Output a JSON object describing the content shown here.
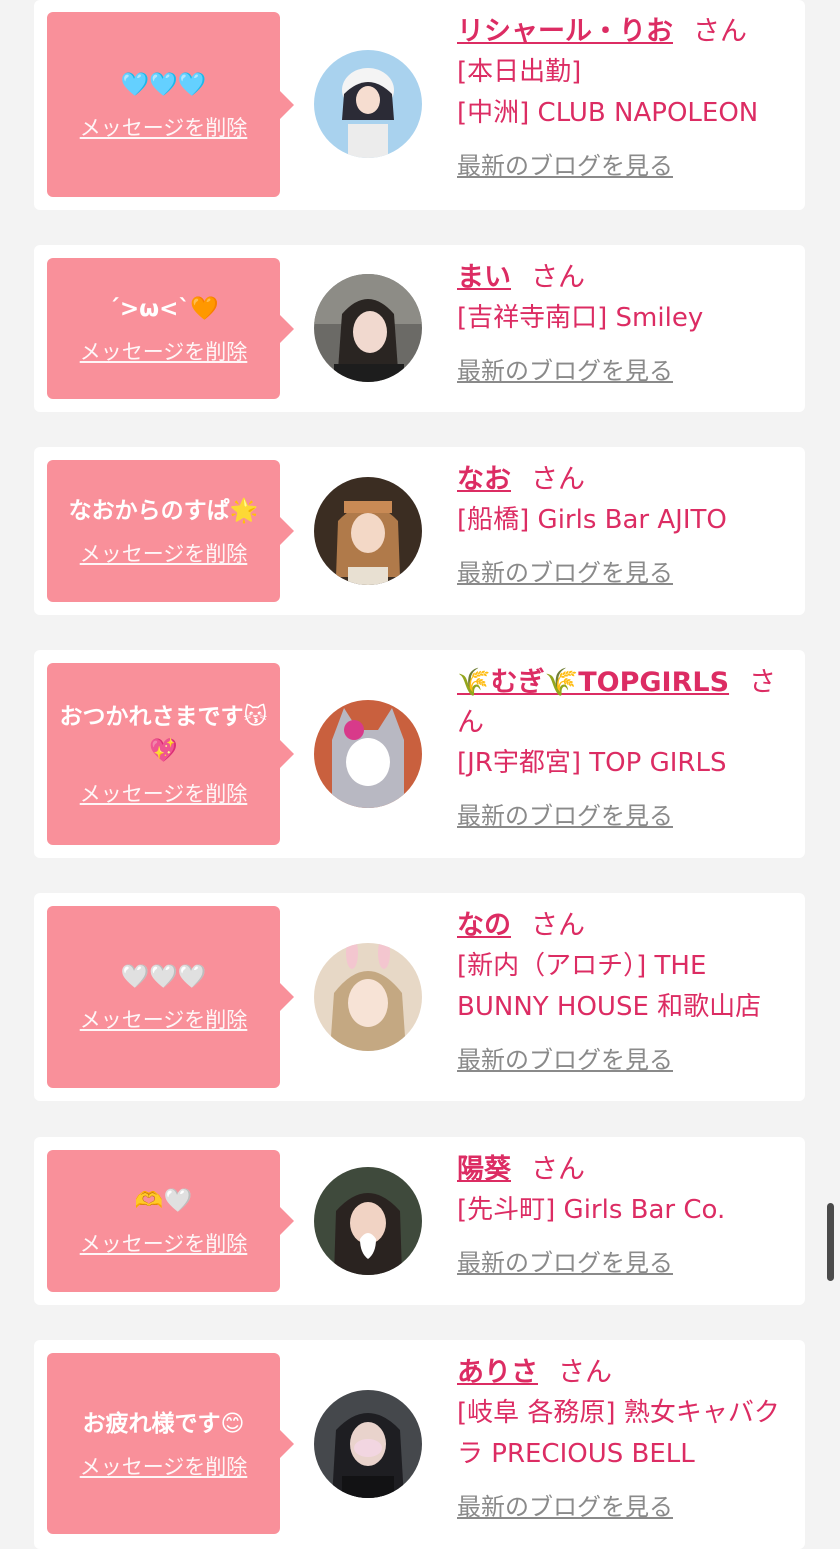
{
  "cards": [
    {
      "message": "🩵🩵🩵",
      "delete_label": "メッセージを削除",
      "name": "リシャール・りお",
      "honorific": "さん",
      "shop_lines": [
        "[本日出勤]",
        "[中洲] CLUB NAPOLEON"
      ],
      "blog_label": "最新のブログを見る"
    },
    {
      "message": "´>ω<`🧡",
      "delete_label": "メッセージを削除",
      "name": "まい",
      "honorific": "さん",
      "shop_lines": [
        "[吉祥寺南口] Smiley"
      ],
      "blog_label": "最新のブログを見る"
    },
    {
      "message": "なおからのすぱ🌟",
      "delete_label": "メッセージを削除",
      "name": "なお",
      "honorific": "さん",
      "shop_lines": [
        "[船橋] Girls Bar AJITO"
      ],
      "blog_label": "最新のブログを見る"
    },
    {
      "message": "おつかれさまです😽💖",
      "delete_label": "メッセージを削除",
      "name": "🌾むぎ🌾TOPGIRLS",
      "honorific": "さん",
      "shop_lines": [
        "[JR宇都宮] TOP GIRLS"
      ],
      "blog_label": "最新のブログを見る"
    },
    {
      "message": "🤍🤍🤍",
      "delete_label": "メッセージを削除",
      "name": "なの",
      "honorific": "さん",
      "shop_lines": [
        "[新内（アロチ）] THE BUNNY HOUSE 和歌山店"
      ],
      "blog_label": "最新のブログを見る"
    },
    {
      "message": "🫶🤍",
      "delete_label": "メッセージを削除",
      "name": "陽葵",
      "honorific": "さん",
      "shop_lines": [
        "[先斗町] Girls Bar Co."
      ],
      "blog_label": "最新のブログを見る"
    },
    {
      "message": "お疲れ様です😊",
      "delete_label": "メッセージを削除",
      "name": "ありさ",
      "honorific": "さん",
      "shop_lines": [
        "[岐阜 各務原] 熟女キャバクラ PRECIOUS BELL"
      ],
      "blog_label": "最新のブログを見る"
    }
  ],
  "colors": {
    "accent": "#dc2c63",
    "bubble": "#f9909a",
    "muted_link": "#8a8a8a",
    "background": "#f3f3f3"
  }
}
